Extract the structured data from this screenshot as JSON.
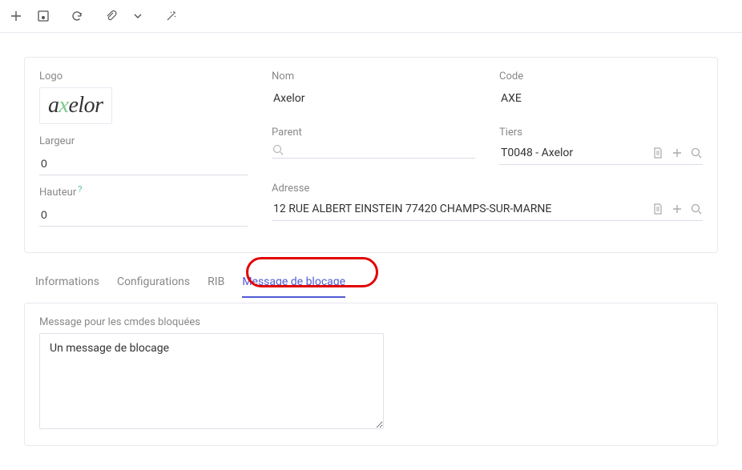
{
  "form": {
    "logo_label": "Logo",
    "logo_brand_pre": "a",
    "logo_brand_x": "x",
    "logo_brand_post": "elor",
    "largeur_label": "Largeur",
    "largeur_value": "0",
    "hauteur_label": "Hauteur",
    "hauteur_value": "0",
    "nom_label": "Nom",
    "nom_value": "Axelor",
    "code_label": "Code",
    "code_value": "AXE",
    "parent_label": "Parent",
    "parent_value": "",
    "tiers_label": "Tiers",
    "tiers_value": "T0048 - Axelor",
    "adresse_label": "Adresse",
    "adresse_value": "12 RUE ALBERT EINSTEIN 77420 CHAMPS-SUR-MARNE"
  },
  "tabs": {
    "t0": "Informations",
    "t1": "Configurations",
    "t2": "RIB",
    "t3": "Message de blocage"
  },
  "blocage": {
    "label": "Message pour les cmdes bloquées",
    "value": "Un message de blocage"
  }
}
